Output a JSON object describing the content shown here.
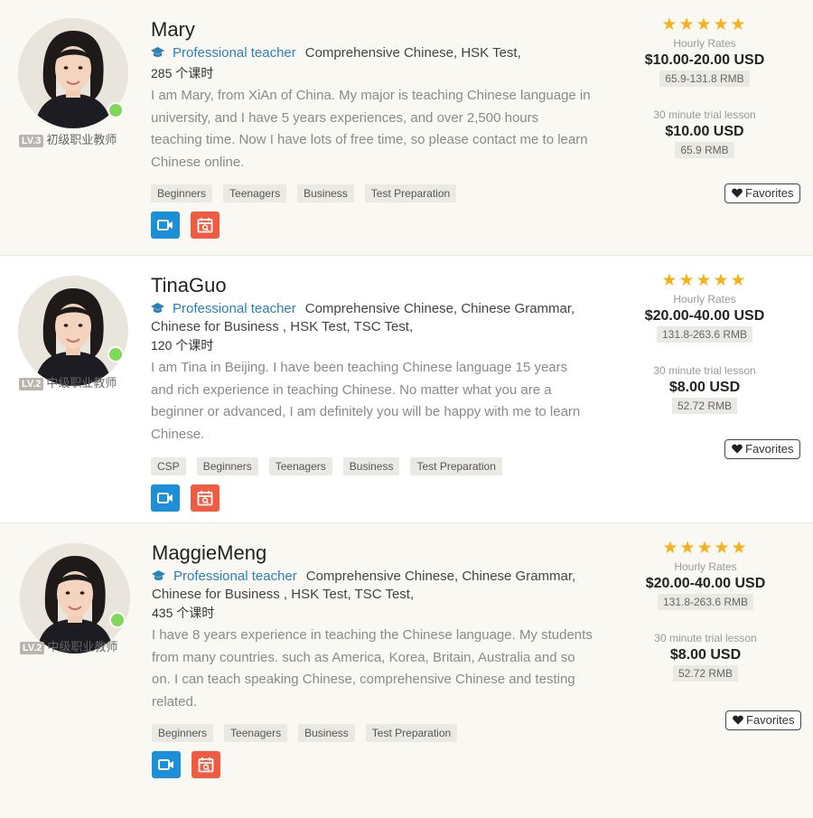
{
  "teachers": [
    {
      "name": "Mary",
      "level_badge": "LV.3",
      "level_text": "初级职业教师",
      "pro_label": "Professional teacher",
      "subjects": "Comprehensive Chinese,  HSK Test,",
      "hours": "285 个课时",
      "bio": "I am Mary, from XiAn of China. My major is teaching Chinese language in university, and I have 5 years experiences, and over 2,500 hours teaching time. Now I have lots of free time, so please contact me to learn Chinese online.",
      "tags": [
        "Beginners",
        "Teenagers",
        "Business",
        "Test Preparation"
      ],
      "rating_stars": 5,
      "stars": "★★★★★",
      "hourly_label": "Hourly Rates",
      "hourly_usd": "$10.00-20.00 USD",
      "hourly_rmb": "65.9-131.8 RMB",
      "trial_label": "30 minute trial lesson",
      "trial_usd": "$10.00  USD",
      "trial_rmb": "65.9 RMB",
      "favorites_label": "Favorites"
    },
    {
      "name": "TinaGuo",
      "level_badge": "LV.2",
      "level_text": "中级职业教师",
      "pro_label": "Professional teacher",
      "subjects": "Comprehensive Chinese,  Chinese Grammar,  Chinese for Business ,  HSK Test,  TSC Test,",
      "hours": "120 个课时",
      "bio": "I am Tina in Beijing. I have been teaching Chinese language 15 years and rich experience in teaching Chinese. No matter what you are a beginner or advanced, I am definitely you will be happy with me to learn Chinese.",
      "tags": [
        "CSP",
        "Beginners",
        "Teenagers",
        "Business",
        "Test Preparation"
      ],
      "rating_stars": 5,
      "stars": "★★★★★",
      "hourly_label": "Hourly Rates",
      "hourly_usd": "$20.00-40.00 USD",
      "hourly_rmb": "131.8-263.6 RMB",
      "trial_label": "30 minute trial lesson",
      "trial_usd": "$8.00  USD",
      "trial_rmb": "52.72 RMB",
      "favorites_label": "Favorites"
    },
    {
      "name": "MaggieMeng",
      "level_badge": "LV.2",
      "level_text": "中级职业教师",
      "pro_label": "Professional teacher",
      "subjects": "Comprehensive Chinese,  Chinese Grammar,  Chinese for Business ,  HSK Test,  TSC Test,",
      "hours": "435 个课时",
      "bio": "I have 8 years experience in teaching the Chinese language. My students from many countries. such as America, Korea, Britain, Australia and so on. I can teach speaking Chinese, comprehensive Chinese and testing related.",
      "tags": [
        "Beginners",
        "Teenagers",
        "Business",
        "Test Preparation"
      ],
      "rating_stars": 5,
      "stars": "★★★★★",
      "hourly_label": "Hourly Rates",
      "hourly_usd": "$20.00-40.00 USD",
      "hourly_rmb": "131.8-263.6 RMB",
      "trial_label": "30 minute trial lesson",
      "trial_usd": "$8.00  USD",
      "trial_rmb": "52.72 RMB",
      "favorites_label": "Favorites"
    }
  ],
  "colors": {
    "accent_blue": "#2c7fb8",
    "star": "#f7b21a",
    "online": "#7ed957",
    "video_button": "#1b8fd8",
    "calendar_button": "#f05b41"
  },
  "icons": {
    "pro": "graduation-cap-icon",
    "video": "video-camera-icon",
    "calendar": "calendar-icon",
    "favorite": "heart-icon",
    "star": "star-icon"
  }
}
